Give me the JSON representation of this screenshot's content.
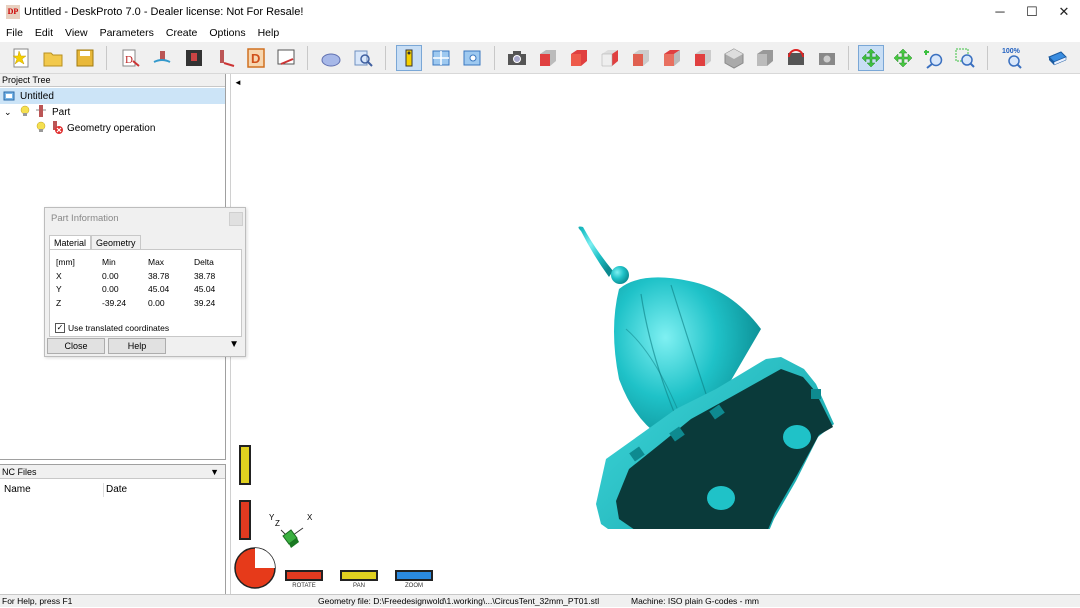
{
  "window": {
    "logo_text": "DP",
    "title": "Untitled - DeskProto 7.0 - Dealer license: Not For Resale!",
    "minimize": "─",
    "maximize": "☐",
    "close": "✕"
  },
  "menu": [
    "File",
    "Edit",
    "View",
    "Parameters",
    "Create",
    "Options",
    "Help"
  ],
  "toolbar": {
    "zoom_label": "100%"
  },
  "project_tree": {
    "header": "Project Tree",
    "root": "Untitled",
    "part": "Part",
    "geometry": "Geometry operation"
  },
  "part_info": {
    "title": "Part Information",
    "tabs": [
      "Material",
      "Geometry"
    ],
    "header": [
      "[mm]",
      "Min",
      "Max",
      "Delta"
    ],
    "rows": [
      [
        "X",
        "0.00",
        "38.78",
        "38.78"
      ],
      [
        "Y",
        "0.00",
        "45.04",
        "45.04"
      ],
      [
        "Z",
        "-39.24",
        "0.00",
        "39.24"
      ]
    ],
    "checkbox_label": "Use translated coordinates",
    "checkbox_checked": true,
    "close_btn": "Close",
    "help_btn": "Help"
  },
  "nc_files": {
    "header": "NC Files",
    "col_name": "Name",
    "col_date": "Date"
  },
  "viewport": {
    "axis_x": "X",
    "axis_y": "Y",
    "axis_z": "Z",
    "rotate": "ROTATE",
    "pan": "PAN",
    "zoom": "ZOOM",
    "collapse_arrow": "◄"
  },
  "status": {
    "help": "For Help, press F1",
    "geometry_file": "Geometry file: D:\\Freedesignwold\\1.working\\...\\CircusTent_32mm_PT01.stl",
    "machine": "Machine: ISO plain G-codes - mm"
  },
  "colors": {
    "model_teal": "#1fc2c8",
    "model_dark": "#0a3a3a",
    "selection": "#cce4f7"
  }
}
